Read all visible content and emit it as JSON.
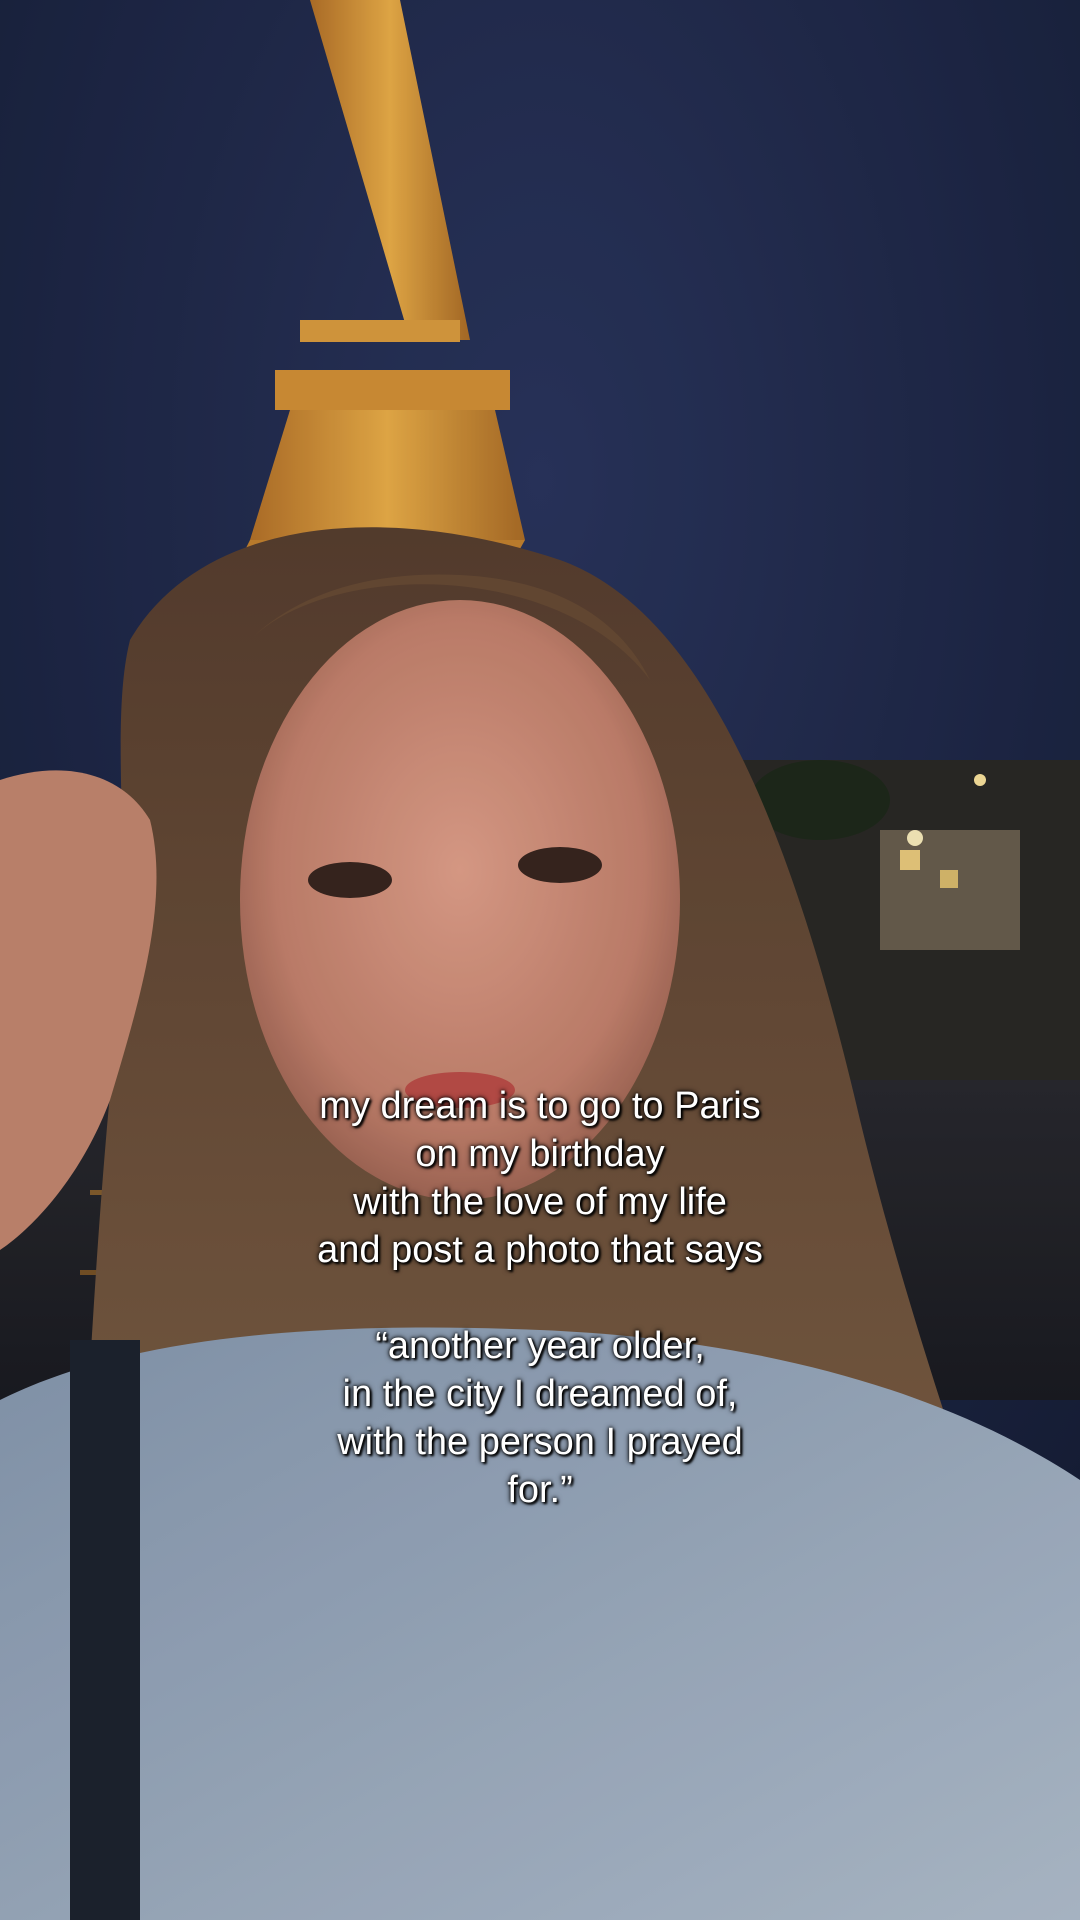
{
  "caption": {
    "lines": [
      "my dream is to go to Paris",
      "on my birthday",
      "with the love of my life",
      "and post a photo that says",
      "",
      "“another year older,",
      "in the city I dreamed of,",
      "with the person I prayed",
      "for.”"
    ]
  },
  "colors": {
    "sky": "#1c2744",
    "tower_light": "#e8a43a",
    "hair": "#7a5a3e",
    "skin": "#d89a86",
    "jacket": "#9fb0c4"
  }
}
